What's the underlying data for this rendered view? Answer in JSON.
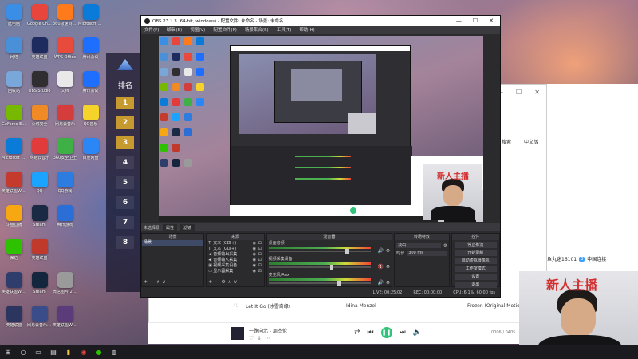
{
  "desktop": {
    "icons": [
      {
        "label": "此电脑",
        "color": "#3a8ee6"
      },
      {
        "label": "Google Chrome",
        "color": "#e8453c"
      },
      {
        "label": "360极速浏览器",
        "color": "#ff7a1a"
      },
      {
        "label": "Microsoft Edge",
        "color": "#0a7bd8"
      },
      {
        "label": "网络",
        "color": "#4a90d9"
      },
      {
        "label": "英雄联盟",
        "color": "#1d2b5e"
      },
      {
        "label": "WPS Office",
        "color": "#e84a3b"
      },
      {
        "label": "腾讯会议",
        "color": "#1e6fff"
      },
      {
        "label": "回收站",
        "color": "#7aa7d9"
      },
      {
        "label": "OBS Studio",
        "color": "#302e31"
      },
      {
        "label": "文档",
        "color": "#e9e9e9"
      },
      {
        "label": "腾讯会议",
        "color": "#1e6fff"
      },
      {
        "label": "GeForce Experience",
        "color": "#76b900"
      },
      {
        "label": "火绒安全",
        "color": "#f08a24"
      },
      {
        "label": "网易云音乐",
        "color": "#d53c3c"
      },
      {
        "label": "QQ音乐",
        "color": "#f5d32a"
      },
      {
        "label": "Microsoft Edge",
        "color": "#0a7bd8"
      },
      {
        "label": "网易云音乐",
        "color": "#e23b3b"
      },
      {
        "label": "360安全卫士",
        "color": "#3fb046"
      },
      {
        "label": "百度网盘",
        "color": "#2a87f5"
      },
      {
        "label": "英雄联盟WeGame",
        "color": "#c43b2e"
      },
      {
        "label": "QQ",
        "color": "#1aa3ff"
      },
      {
        "label": "QQ游戏",
        "color": "#2d7de0"
      },
      {
        "label": "",
        "color": "transparent"
      },
      {
        "label": "斗鱼直播",
        "color": "#f7a712"
      },
      {
        "label": "Steam",
        "color": "#1b2a44"
      },
      {
        "label": "腾讯游戏",
        "color": "#2b6fd6"
      },
      {
        "label": "",
        "color": "transparent"
      },
      {
        "label": "微信",
        "color": "#2dc100"
      },
      {
        "label": "英雄联盟",
        "color": "#c0392b"
      },
      {
        "label": "",
        "color": "transparent"
      },
      {
        "label": "",
        "color": "transparent"
      },
      {
        "label": "英雄联盟WeGame",
        "color": "#2e3d6b"
      },
      {
        "label": "Steam",
        "color": "#14263e"
      },
      {
        "label": "微信图片 2022000...",
        "color": "#9a9a9a"
      },
      {
        "label": "",
        "color": "transparent"
      },
      {
        "label": "英雄联盟",
        "color": "#2b3560"
      },
      {
        "label": "网易云音乐WeGame",
        "color": "#3a4c8a"
      },
      {
        "label": "英雄联盟WeGame",
        "color": "#5b3b7a"
      },
      {
        "label": "",
        "color": "transparent"
      }
    ],
    "leaderboard": {
      "title": "排名",
      "ranks": [
        "1",
        "2",
        "3",
        "4",
        "5",
        "6",
        "7",
        "8"
      ]
    }
  },
  "obs": {
    "title": "OBS 27.1.3 (64-bit, windows) - 配置文件: 未命名 - 场景: 未命名",
    "menu": [
      "文件(F)",
      "编辑(E)",
      "视图(V)",
      "配置文件(P)",
      "场景集合(S)",
      "工具(T)",
      "帮助(H)"
    ],
    "scene_tabs": [
      "未选择源",
      "属性",
      "滤镜"
    ],
    "docks": {
      "scenes": {
        "header": "场景",
        "items": [
          "场景"
        ]
      },
      "sources": {
        "header": "来源",
        "items": [
          {
            "icon": "T",
            "name": "文本 (GDI+)"
          },
          {
            "icon": "T",
            "name": "文本 (GDI+)"
          },
          {
            "icon": "◀",
            "name": "音频输出采集"
          },
          {
            "icon": "◀",
            "name": "音频输入采集"
          },
          {
            "icon": "▣",
            "name": "视频采集设备"
          },
          {
            "icon": "▭",
            "name": "显示器采集"
          }
        ]
      },
      "mixer": {
        "header": "混音器",
        "channels": [
          {
            "name": "桌面音频",
            "level": 0.78,
            "muted": false
          },
          {
            "name": "视频采集设备",
            "level": 0.62,
            "muted": true
          },
          {
            "name": "麦克风/Aux",
            "level": 0.7,
            "muted": false
          }
        ]
      },
      "transitions": {
        "header": "转场特效",
        "type": "淡出",
        "duration_label": "时长",
        "duration": "300 ms"
      },
      "controls": {
        "header": "控件",
        "buttons": [
          "停止推流",
          "开始录制",
          "启动虚拟摄像机",
          "工作室模式",
          "设置",
          "退出"
        ]
      }
    },
    "status": {
      "live": "LIVE: 00:25:02",
      "rec": "REC: 00:00:00",
      "cpu": "CPU: 6.1%, 60.00 fps"
    }
  },
  "overlay_tag": "新人主播",
  "music": {
    "search_label": "搜索",
    "lang_label": "中文版",
    "track": {
      "title": "Let It Go (冰雪奇缘)",
      "artist": "Idina Menzel",
      "album": "Frozen (Original Motion Picture"
    },
    "now_playing": "一路向北 - 周杰伦",
    "time": "0006 / 0405"
  },
  "chat": {
    "user": "鱼丸迷16101",
    "badge": "3",
    "caption": "中国连接"
  },
  "taskbar": {
    "items": [
      "start-icon",
      "search-icon",
      "taskview-icon",
      "explorer-icon",
      "files-icon",
      "chrome-icon",
      "wechat-icon",
      "obs-icon"
    ]
  }
}
